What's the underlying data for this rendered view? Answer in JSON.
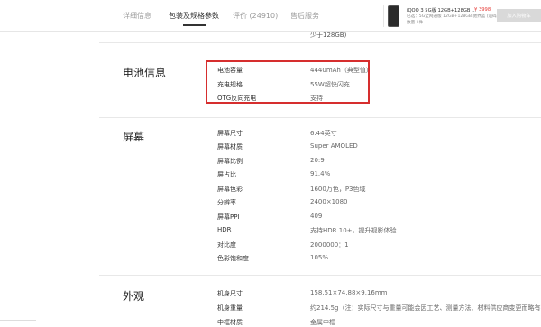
{
  "tabs": [
    {
      "label": "详细信息"
    },
    {
      "label": "包装及规格参数"
    },
    {
      "label": "评价 (24910)"
    },
    {
      "label": "售后服务"
    }
  ],
  "product": {
    "title": "iQOO 3 5G版 12GB+128GB ...",
    "price": "¥ 3998",
    "subtitle": "已选：5G全网通版 12GB+128GB 驰界蓝 (送碎屏险)",
    "quantity": "数量 1件",
    "buy_label": "加入购物车"
  },
  "top_value": "少于128GB)",
  "sections": [
    {
      "title": "电池信息",
      "rows": [
        {
          "label": "电池容量",
          "value": "4440mAh（典型值）"
        },
        {
          "label": "充电规格",
          "value": "55W超快闪充"
        },
        {
          "label": "OTG反向充电",
          "value": "支持"
        }
      ]
    },
    {
      "title": "屏幕",
      "rows": [
        {
          "label": "屏幕尺寸",
          "value": "6.44英寸"
        },
        {
          "label": "屏幕材质",
          "value": "Super AMOLED"
        },
        {
          "label": "屏幕比例",
          "value": "20:9"
        },
        {
          "label": "屏占比",
          "value": "91.4%"
        },
        {
          "label": "屏幕色彩",
          "value": "1600万色，P3色域"
        },
        {
          "label": "分辨率",
          "value": "2400×1080"
        },
        {
          "label": "屏幕PPI",
          "value": "409"
        },
        {
          "label": "HDR",
          "value": "支持HDR 10+，提升视影体验"
        },
        {
          "label": "对比度",
          "value": "2000000：1"
        },
        {
          "label": "色彩饱和度",
          "value": "105%"
        }
      ]
    },
    {
      "title": "外观",
      "rows": [
        {
          "label": "机身尺寸",
          "value": "158.51×74.88×9.16mm"
        },
        {
          "label": "机身重量",
          "value": "约214.5g（注：实际尺寸与重量可能会因工艺、测量方法、材料供应商变更而略有不同）"
        },
        {
          "label": "中框材质",
          "value": "金属中框"
        }
      ]
    }
  ]
}
